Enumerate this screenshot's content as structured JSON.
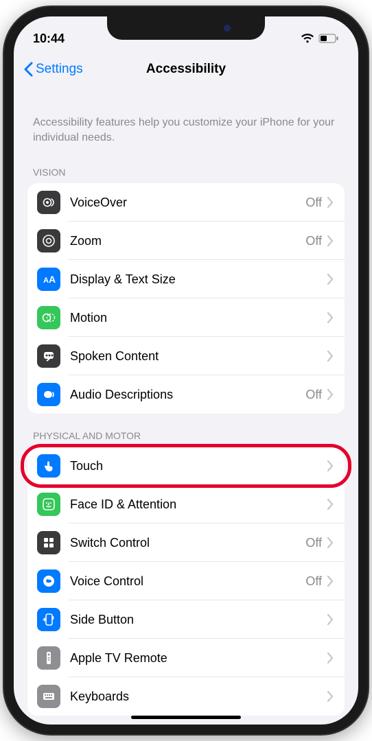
{
  "status": {
    "time": "10:44"
  },
  "nav": {
    "back": "Settings",
    "title": "Accessibility"
  },
  "intro": "Accessibility features help you customize your iPhone for your individual needs.",
  "sections": {
    "vision": {
      "header": "VISION",
      "rows": {
        "voiceover": {
          "label": "VoiceOver",
          "value": "Off"
        },
        "zoom": {
          "label": "Zoom",
          "value": "Off"
        },
        "display": {
          "label": "Display & Text Size",
          "value": ""
        },
        "motion": {
          "label": "Motion",
          "value": ""
        },
        "spoken": {
          "label": "Spoken Content",
          "value": ""
        },
        "audio": {
          "label": "Audio Descriptions",
          "value": "Off"
        }
      }
    },
    "physical": {
      "header": "PHYSICAL AND MOTOR",
      "rows": {
        "touch": {
          "label": "Touch",
          "value": ""
        },
        "faceid": {
          "label": "Face ID & Attention",
          "value": ""
        },
        "switch": {
          "label": "Switch Control",
          "value": "Off"
        },
        "voice": {
          "label": "Voice Control",
          "value": "Off"
        },
        "side": {
          "label": "Side Button",
          "value": ""
        },
        "tvremote": {
          "label": "Apple TV Remote",
          "value": ""
        },
        "keyboards": {
          "label": "Keyboards",
          "value": ""
        }
      }
    }
  }
}
